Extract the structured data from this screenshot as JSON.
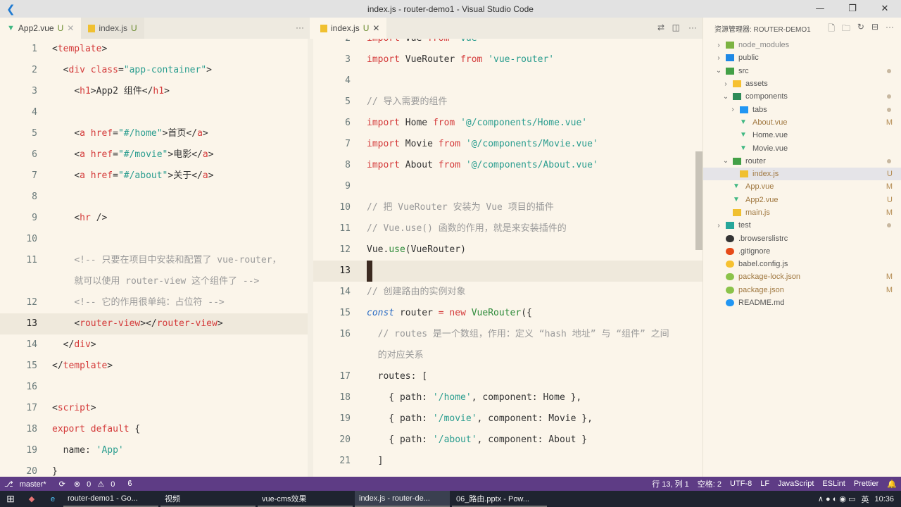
{
  "window": {
    "title": "index.js - router-demo1 - Visual Studio Code"
  },
  "left_tabs": [
    {
      "label": "App2.vue",
      "status": "U",
      "icon": "vue-icon"
    },
    {
      "label": "index.js",
      "status": "U",
      "icon": "js-icon"
    }
  ],
  "right_tabs": [
    {
      "label": "index.js",
      "status": "U",
      "icon": "js-icon"
    }
  ],
  "left_editor": {
    "lines": [
      {
        "n": "1",
        "t": [
          [
            "tag",
            "<"
          ],
          [
            "name",
            "template"
          ],
          [
            "tag",
            ">"
          ]
        ]
      },
      {
        "n": "2",
        "t": [
          [
            "p",
            "  "
          ],
          [
            "tag",
            "<"
          ],
          [
            "name",
            "div"
          ],
          [
            "p",
            " "
          ],
          [
            "attr",
            "class"
          ],
          [
            "p",
            "="
          ],
          [
            "str",
            "\"app-container\""
          ],
          [
            "tag",
            ">"
          ]
        ]
      },
      {
        "n": "3",
        "t": [
          [
            "p",
            "    "
          ],
          [
            "tag",
            "<"
          ],
          [
            "name",
            "h1"
          ],
          [
            "tag",
            ">"
          ],
          [
            "p",
            "App2 组件"
          ],
          [
            "tag",
            "</"
          ],
          [
            "name",
            "h1"
          ],
          [
            "tag",
            ">"
          ]
        ]
      },
      {
        "n": "4",
        "t": []
      },
      {
        "n": "5",
        "t": [
          [
            "p",
            "    "
          ],
          [
            "tag",
            "<"
          ],
          [
            "name",
            "a"
          ],
          [
            "p",
            " "
          ],
          [
            "attr",
            "href"
          ],
          [
            "p",
            "="
          ],
          [
            "str",
            "\"#/home\""
          ],
          [
            "tag",
            ">"
          ],
          [
            "p",
            "首页"
          ],
          [
            "tag",
            "</"
          ],
          [
            "name",
            "a"
          ],
          [
            "tag",
            ">"
          ]
        ]
      },
      {
        "n": "6",
        "t": [
          [
            "p",
            "    "
          ],
          [
            "tag",
            "<"
          ],
          [
            "name",
            "a"
          ],
          [
            "p",
            " "
          ],
          [
            "attr",
            "href"
          ],
          [
            "p",
            "="
          ],
          [
            "str",
            "\"#/movie\""
          ],
          [
            "tag",
            ">"
          ],
          [
            "p",
            "电影"
          ],
          [
            "tag",
            "</"
          ],
          [
            "name",
            "a"
          ],
          [
            "tag",
            ">"
          ]
        ]
      },
      {
        "n": "7",
        "t": [
          [
            "p",
            "    "
          ],
          [
            "tag",
            "<"
          ],
          [
            "name",
            "a"
          ],
          [
            "p",
            " "
          ],
          [
            "attr",
            "href"
          ],
          [
            "p",
            "="
          ],
          [
            "str",
            "\"#/about\""
          ],
          [
            "tag",
            ">"
          ],
          [
            "p",
            "关于"
          ],
          [
            "tag",
            "</"
          ],
          [
            "name",
            "a"
          ],
          [
            "tag",
            ">"
          ]
        ]
      },
      {
        "n": "8",
        "t": []
      },
      {
        "n": "9",
        "t": [
          [
            "p",
            "    "
          ],
          [
            "tag",
            "<"
          ],
          [
            "name",
            "hr"
          ],
          [
            "p",
            " "
          ],
          [
            "tag",
            "/>"
          ]
        ]
      },
      {
        "n": "10",
        "t": []
      },
      {
        "n": "11",
        "t": [
          [
            "p",
            "    "
          ],
          [
            "cm",
            "<!-- 只要在项目中安装和配置了 vue-router，"
          ]
        ]
      },
      {
        "n": "",
        "t": [
          [
            "p",
            "    "
          ],
          [
            "cm",
            "就可以使用 router-view 这个组件了 -->"
          ]
        ]
      },
      {
        "n": "12",
        "t": [
          [
            "p",
            "    "
          ],
          [
            "cm",
            "<!-- 它的作用很单纯：占位符 -->"
          ]
        ]
      },
      {
        "n": "13",
        "t": [
          [
            "p",
            "    "
          ],
          [
            "tag",
            "<"
          ],
          [
            "name",
            "router-view"
          ],
          [
            "tag",
            "></"
          ],
          [
            "name",
            "router-view"
          ],
          [
            "tag",
            ">"
          ]
        ],
        "current": true
      },
      {
        "n": "14",
        "t": [
          [
            "p",
            "  "
          ],
          [
            "tag",
            "</"
          ],
          [
            "name",
            "div"
          ],
          [
            "tag",
            ">"
          ]
        ]
      },
      {
        "n": "15",
        "t": [
          [
            "tag",
            "</"
          ],
          [
            "name",
            "template"
          ],
          [
            "tag",
            ">"
          ]
        ]
      },
      {
        "n": "16",
        "t": []
      },
      {
        "n": "17",
        "t": [
          [
            "tag",
            "<"
          ],
          [
            "name",
            "script"
          ],
          [
            "tag",
            ">"
          ]
        ]
      },
      {
        "n": "18",
        "t": [
          [
            "kw",
            "export"
          ],
          [
            "p",
            " "
          ],
          [
            "kw",
            "default"
          ],
          [
            "p",
            " {"
          ]
        ]
      },
      {
        "n": "19",
        "t": [
          [
            "p",
            "  name: "
          ],
          [
            "str",
            "'App'"
          ]
        ]
      },
      {
        "n": "20",
        "t": [
          [
            "p",
            "}"
          ]
        ]
      }
    ]
  },
  "right_editor": {
    "lines": [
      {
        "n": "2",
        "t": [
          [
            "kw",
            "import"
          ],
          [
            "p",
            " Vue "
          ],
          [
            "kw",
            "from"
          ],
          [
            "p",
            " "
          ],
          [
            "str",
            "'vue'"
          ]
        ]
      },
      {
        "n": "3",
        "t": [
          [
            "kw",
            "import"
          ],
          [
            "p",
            " VueRouter "
          ],
          [
            "kw",
            "from"
          ],
          [
            "p",
            " "
          ],
          [
            "str",
            "'vue-router'"
          ]
        ]
      },
      {
        "n": "4",
        "t": []
      },
      {
        "n": "5",
        "t": [
          [
            "cm",
            "// 导入需要的组件"
          ]
        ]
      },
      {
        "n": "6",
        "t": [
          [
            "kw",
            "import"
          ],
          [
            "p",
            " Home "
          ],
          [
            "kw",
            "from"
          ],
          [
            "p",
            " "
          ],
          [
            "str",
            "'@/components/Home.vue'"
          ]
        ]
      },
      {
        "n": "7",
        "t": [
          [
            "kw",
            "import"
          ],
          [
            "p",
            " Movie "
          ],
          [
            "kw",
            "from"
          ],
          [
            "p",
            " "
          ],
          [
            "str",
            "'@/components/Movie.vue'"
          ]
        ]
      },
      {
        "n": "8",
        "t": [
          [
            "kw",
            "import"
          ],
          [
            "p",
            " About "
          ],
          [
            "kw",
            "from"
          ],
          [
            "p",
            " "
          ],
          [
            "str",
            "'@/components/About.vue'"
          ]
        ]
      },
      {
        "n": "9",
        "t": []
      },
      {
        "n": "10",
        "t": [
          [
            "cm",
            "// 把 VueRouter 安装为 Vue 项目的插件"
          ]
        ]
      },
      {
        "n": "11",
        "t": [
          [
            "cm",
            "// Vue.use() 函数的作用，就是来安装插件的"
          ]
        ]
      },
      {
        "n": "12",
        "t": [
          [
            "p",
            "Vue."
          ],
          [
            "fn",
            "use"
          ],
          [
            "p",
            "(VueRouter)"
          ]
        ]
      },
      {
        "n": "13",
        "t": [],
        "current": true
      },
      {
        "n": "14",
        "t": [
          [
            "cm",
            "// 创建路由的实例对象"
          ]
        ]
      },
      {
        "n": "15",
        "t": [
          [
            "it",
            "const"
          ],
          [
            "p",
            " router "
          ],
          [
            "op",
            "="
          ],
          [
            "p",
            " "
          ],
          [
            "kw",
            "new"
          ],
          [
            "p",
            " "
          ],
          [
            "cls",
            "VueRouter"
          ],
          [
            "p",
            "({"
          ]
        ]
      },
      {
        "n": "16",
        "t": [
          [
            "p",
            "  "
          ],
          [
            "cm",
            "// routes 是一个数组，作用：定义 “hash 地址” 与 “组件” 之间"
          ]
        ]
      },
      {
        "n": "",
        "t": [
          [
            "p",
            "  "
          ],
          [
            "cm",
            "的对应关系"
          ]
        ]
      },
      {
        "n": "17",
        "t": [
          [
            "p",
            "  routes: ["
          ]
        ]
      },
      {
        "n": "18",
        "t": [
          [
            "p",
            "    { path: "
          ],
          [
            "str",
            "'/home'"
          ],
          [
            "p",
            ", component: Home },"
          ]
        ]
      },
      {
        "n": "19",
        "t": [
          [
            "p",
            "    { path: "
          ],
          [
            "str",
            "'/movie'"
          ],
          [
            "p",
            ", component: Movie },"
          ]
        ]
      },
      {
        "n": "20",
        "t": [
          [
            "p",
            "    { path: "
          ],
          [
            "str",
            "'/about'"
          ],
          [
            "p",
            ", component: About }"
          ]
        ]
      },
      {
        "n": "21",
        "t": [
          [
            "p",
            "  ]"
          ]
        ]
      }
    ]
  },
  "explorer": {
    "title": "资源管理器: ROUTER-DEMO1",
    "items": [
      {
        "label": "node_modules",
        "depth": 0,
        "kind": "folder",
        "open": false,
        "color": "#7cb342"
      },
      {
        "label": "public",
        "depth": 0,
        "kind": "folder",
        "open": false,
        "color": "#1e88e5"
      },
      {
        "label": "src",
        "depth": 0,
        "kind": "folder",
        "open": true,
        "color": "#43a047",
        "dot": true
      },
      {
        "label": "assets",
        "depth": 1,
        "kind": "folder",
        "open": false,
        "color": "#f6c131"
      },
      {
        "label": "components",
        "depth": 1,
        "kind": "folder",
        "open": true,
        "color": "#2e8b57",
        "dot": true
      },
      {
        "label": "tabs",
        "depth": 2,
        "kind": "folder",
        "open": false,
        "color": "#2196f3",
        "dot": true
      },
      {
        "label": "About.vue",
        "depth": 2,
        "kind": "vue",
        "status": "M"
      },
      {
        "label": "Home.vue",
        "depth": 2,
        "kind": "vue"
      },
      {
        "label": "Movie.vue",
        "depth": 2,
        "kind": "vue"
      },
      {
        "label": "router",
        "depth": 1,
        "kind": "folder",
        "open": true,
        "color": "#43a047",
        "dot": true
      },
      {
        "label": "index.js",
        "depth": 2,
        "kind": "js",
        "status": "U",
        "selected": true
      },
      {
        "label": "App.vue",
        "depth": 1,
        "kind": "vue",
        "status": "M"
      },
      {
        "label": "App2.vue",
        "depth": 1,
        "kind": "vue",
        "status": "U"
      },
      {
        "label": "main.js",
        "depth": 1,
        "kind": "js",
        "status": "M"
      },
      {
        "label": "test",
        "depth": 0,
        "kind": "folder",
        "open": false,
        "color": "#26a69a",
        "dot": true
      },
      {
        "label": ".browserslistrc",
        "depth": 0,
        "kind": "file",
        "color": "#333"
      },
      {
        "label": ".gitignore",
        "depth": 0,
        "kind": "file",
        "color": "#e64a19"
      },
      {
        "label": "babel.config.js",
        "depth": 0,
        "kind": "file",
        "color": "#f6c131"
      },
      {
        "label": "package-lock.json",
        "depth": 0,
        "kind": "file",
        "color": "#8bc34a",
        "status": "M"
      },
      {
        "label": "package.json",
        "depth": 0,
        "kind": "file",
        "color": "#8bc34a",
        "status": "M"
      },
      {
        "label": "README.md",
        "depth": 0,
        "kind": "file",
        "color": "#2196f3"
      }
    ]
  },
  "status_bar": {
    "branch": "master*",
    "errors": "0",
    "warnings": "0",
    "position": "行 13, 列 1",
    "spaces": "空格: 2",
    "encoding": "UTF-8",
    "eol": "LF",
    "lang": "JavaScript",
    "extra": "ESLint",
    "formatter": "Prettier"
  },
  "taskbar": {
    "items": [
      {
        "label": "router-demo1 - Go..."
      },
      {
        "label": "视频"
      },
      {
        "label": "vue-cms效果"
      },
      {
        "label": "index.js - router-de...",
        "active": true
      },
      {
        "label": "06_路由.pptx - Pow..."
      }
    ],
    "ime": "英",
    "clock": "10:36"
  }
}
